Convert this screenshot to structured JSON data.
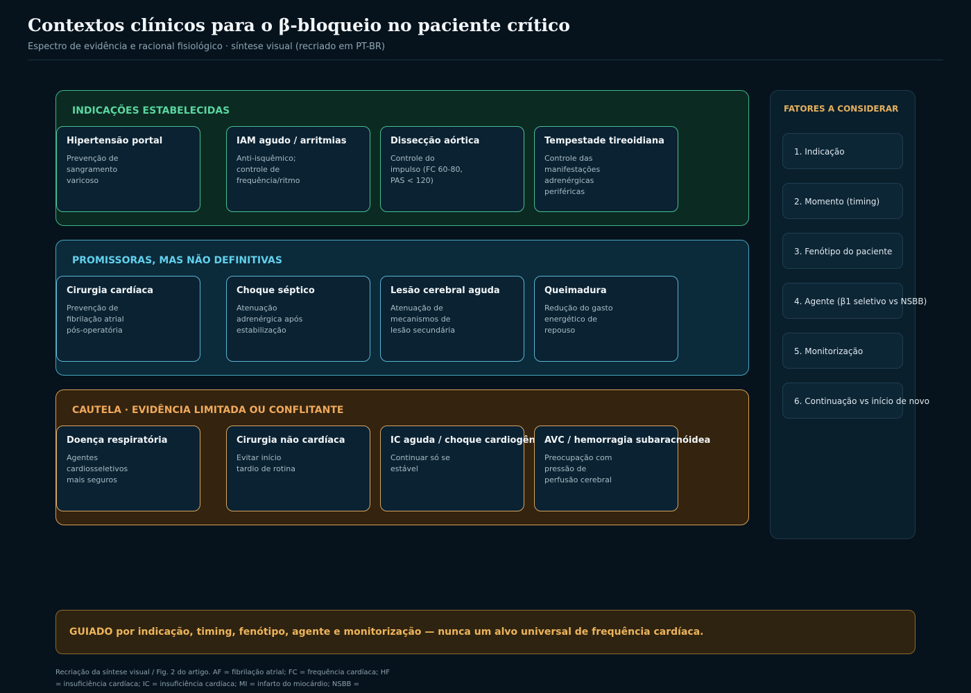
{
  "header": {
    "title": "Contextos clínicos para o β-bloqueio no paciente crítico",
    "subtitle": "Espectro de evidência e racional fisiológico · síntese visual (recriado em PT-BR)"
  },
  "bands": [
    {
      "title": "INDICAÇÕES ESTABELECIDAS",
      "color": "#5ad6a0",
      "cards": [
        {
          "title": "IAM agudo / arritmias",
          "lines": [
            "Anti-isquêmico;",
            "controle de",
            "frequência/ritmo"
          ]
        },
        {
          "title": "Dissecção aórtica",
          "lines": [
            "Controle do",
            "impulso (FC 60-80,",
            "PAS < 120)"
          ]
        },
        {
          "title": "Tempestade tireoidiana",
          "lines": [
            "Controle das",
            "manifestações",
            "adrenérgicas",
            "periféricas"
          ]
        },
        {
          "title": "Hipertensão portal",
          "lines": [
            "Prevenção de",
            "sangramento",
            "varicoso"
          ]
        }
      ]
    },
    {
      "title": "PROMISSORAS, MAS NÃO DEFINITIVAS",
      "color": "#62d0ec",
      "cards": [
        {
          "title": "Choque séptico",
          "lines": [
            "Atenuação",
            "adrenérgica após",
            "estabilização"
          ]
        },
        {
          "title": "Lesão cerebral aguda",
          "lines": [
            "Atenuação de",
            "mecanismos de",
            "lesão secundária"
          ]
        },
        {
          "title": "Queimadura",
          "lines": [
            "Redução do gasto",
            "energético de",
            "repouso"
          ]
        },
        {
          "title": "Cirurgia cardíaca",
          "lines": [
            "Prevenção de",
            "fibrilação atrial",
            "pós-operatória"
          ]
        }
      ]
    },
    {
      "title": "CAUTELA · EVIDÊNCIA LIMITADA OU CONFLITANTE",
      "color": "#f0a95c",
      "cards": [
        {
          "title": "Cirurgia não cardíaca",
          "lines": [
            "Evitar início",
            "tardio de rotina"
          ]
        },
        {
          "title": "IC aguda / choque cardiogênico",
          "lines": [
            "Continuar só se",
            "estável"
          ]
        },
        {
          "title": "AVC / hemorragia subaracnóidea",
          "lines": [
            "Preocupação com",
            "pressão de",
            "perfusão cerebral"
          ]
        },
        {
          "title": "Doença respiratória",
          "lines": [
            "Agentes",
            "cardiosseletivos",
            "mais seguros"
          ]
        }
      ]
    }
  ],
  "side_panel": {
    "title": "FATORES A CONSIDERAR",
    "items": [
      "1. Indicação",
      "2. Momento (timing)",
      "3. Fenótipo do paciente",
      "4. Agente (β1 seletivo vs NSBB)",
      "5. Monitorização",
      "6. Continuação vs início de novo"
    ]
  },
  "footer": {
    "message": "GUIADO por indicação, timing, fenótipo, agente e monitorização — nunca um alvo universal de frequência cardíaca.",
    "notes": [
      "Recriação da síntese visual / Fig. 2 do artigo. AF = fibrilação atrial; FC = frequência cardíaca; HF",
      "= insuficiência cardíaca; IC = insuficiência cardíaca; MI = infarto do miocárdio; NSBB ="
    ]
  }
}
